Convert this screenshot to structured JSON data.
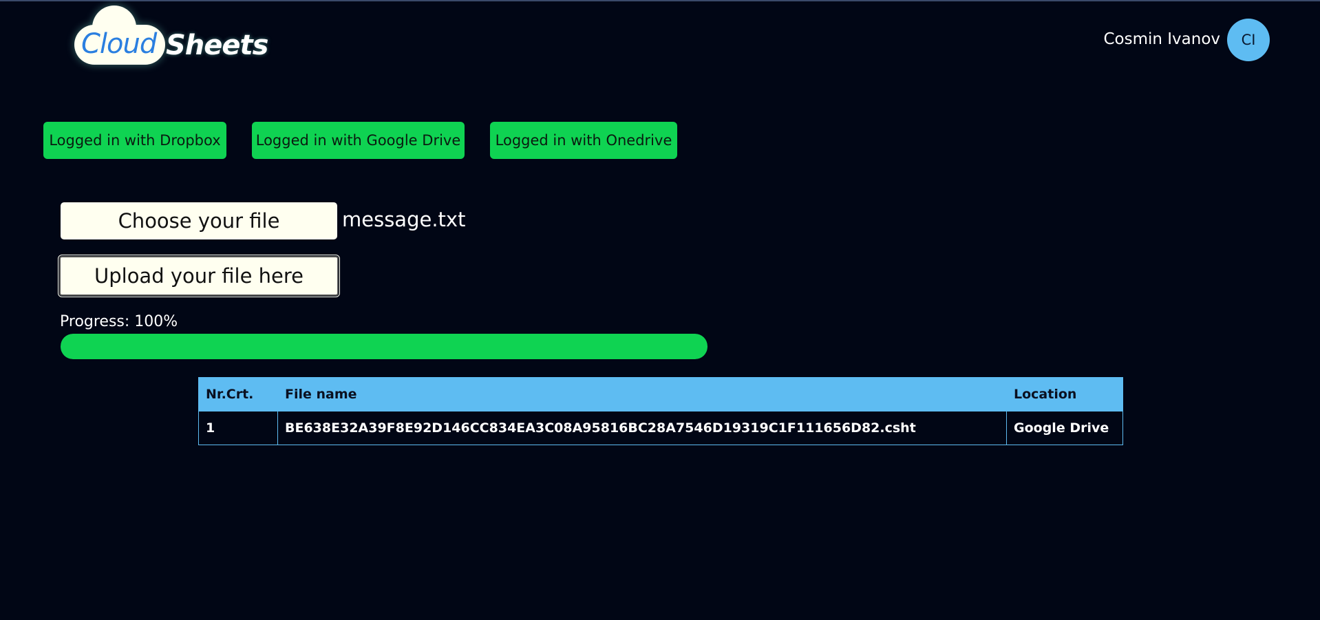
{
  "logo": {
    "part1": "Cloud",
    "part2": "Sheets"
  },
  "user": {
    "name": "Cosmin Ivanov",
    "initials": "CI",
    "avatar_color": "#5ebcf2"
  },
  "providers": [
    {
      "label": "Logged in with Dropbox"
    },
    {
      "label": "Logged in with Google Drive"
    },
    {
      "label": "Logged in with Onedrive"
    }
  ],
  "file_picker": {
    "choose_label": "Choose your file",
    "selected_file": "message.txt"
  },
  "upload": {
    "label": "Upload your file here"
  },
  "progress": {
    "label": "Progress: 100%",
    "value_percent": 100
  },
  "table": {
    "headers": [
      "Nr.Crt.",
      "File name",
      "Location"
    ],
    "rows": [
      [
        "1",
        "BE638E32A39F8E92D146CC834EA3C08A95816BC28A7546D19319C1F111656D82.csht",
        "Google Drive"
      ]
    ]
  },
  "colors": {
    "background": "#010615",
    "success": "#0fd352",
    "accent": "#5ebcf2",
    "light": "#fffff0"
  }
}
